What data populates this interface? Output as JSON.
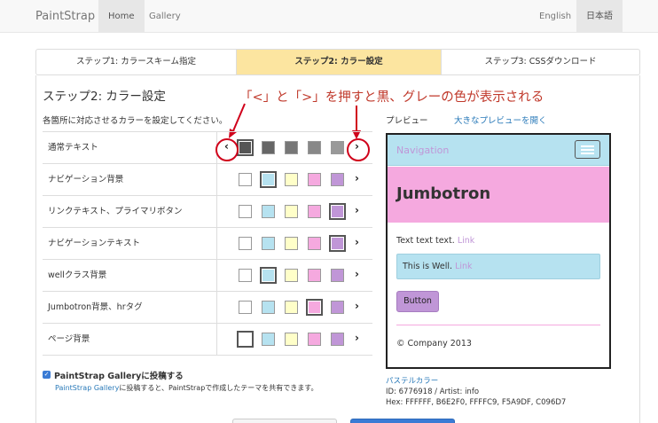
{
  "navbar": {
    "brand": "PaintStrap",
    "links": [
      {
        "label": "Home"
      },
      {
        "label": "Gallery"
      }
    ],
    "languages": [
      {
        "label": "English"
      },
      {
        "label": "日本語"
      }
    ]
  },
  "steps": [
    {
      "label": "ステップ1: カラースキーム指定"
    },
    {
      "label": "ステップ2: カラー設定"
    },
    {
      "label": "ステップ3: CSSダウンロード"
    }
  ],
  "main": {
    "title": "ステップ2: カラー設定",
    "description": "各箇所に対応させるカラーを設定してください。",
    "annotation": "「<」と「>」を押すと黒、グレーの色が表示される"
  },
  "colors": {
    "white": "#FFFFFF",
    "blue": "#B6E2F0",
    "yellow": "#FFFFC9",
    "pink": "#F5A9DF",
    "purple": "#C096D7",
    "accent_red": "#D0021B"
  },
  "color_rows": [
    {
      "label": "通常テキスト",
      "swatches": [
        "#555555",
        "#666666",
        "#777777",
        "#888888",
        "#999999"
      ],
      "selected": 0,
      "has_prev": true
    },
    {
      "label": "ナビゲーション背景",
      "swatches": [
        "#FFFFFF",
        "#B6E2F0",
        "#FFFFC9",
        "#F5A9DF",
        "#C096D7"
      ],
      "selected": 1,
      "has_prev": false
    },
    {
      "label": "リンクテキスト、プライマリボタン",
      "swatches": [
        "#FFFFFF",
        "#B6E2F0",
        "#FFFFC9",
        "#F5A9DF",
        "#C096D7"
      ],
      "selected": 4,
      "has_prev": false
    },
    {
      "label": "ナビゲーションテキスト",
      "swatches": [
        "#FFFFFF",
        "#B6E2F0",
        "#FFFFC9",
        "#F5A9DF",
        "#C096D7"
      ],
      "selected": 4,
      "has_prev": false
    },
    {
      "label": "wellクラス背景",
      "swatches": [
        "#FFFFFF",
        "#B6E2F0",
        "#FFFFC9",
        "#F5A9DF",
        "#C096D7"
      ],
      "selected": 1,
      "has_prev": false
    },
    {
      "label": "Jumbotron背景、hrタグ",
      "swatches": [
        "#FFFFFF",
        "#B6E2F0",
        "#FFFFC9",
        "#F5A9DF",
        "#C096D7"
      ],
      "selected": 3,
      "has_prev": false
    },
    {
      "label": "ページ背景",
      "swatches": [
        "#FFFFFF",
        "#B6E2F0",
        "#FFFFC9",
        "#F5A9DF",
        "#C096D7"
      ],
      "selected": 0,
      "has_prev": false
    }
  ],
  "preview": {
    "label": "プレビュー",
    "large_link": "大きなプレビューを開く",
    "nav_brand": "Navigation",
    "jumbotron": "Jumbotron",
    "text": "Text text text.",
    "link": "Link",
    "well_text": "This is Well.",
    "well_link": "Link",
    "button": "Button",
    "footer": "© Company 2013"
  },
  "scheme": {
    "name": "パステルカラー",
    "id_line": "ID: 6776918 / Artist: info",
    "hex_line": "Hex: FFFFFF, B6E2F0, FFFFC9, F5A9DF, C096D7"
  },
  "gallery": {
    "checked": true,
    "title": "PaintStrap Galleryに投稿する",
    "desc_link": "PaintStrap Gallery",
    "desc_rest": "に投稿すると、PaintStrapで作成したテーマを共有できます。"
  }
}
